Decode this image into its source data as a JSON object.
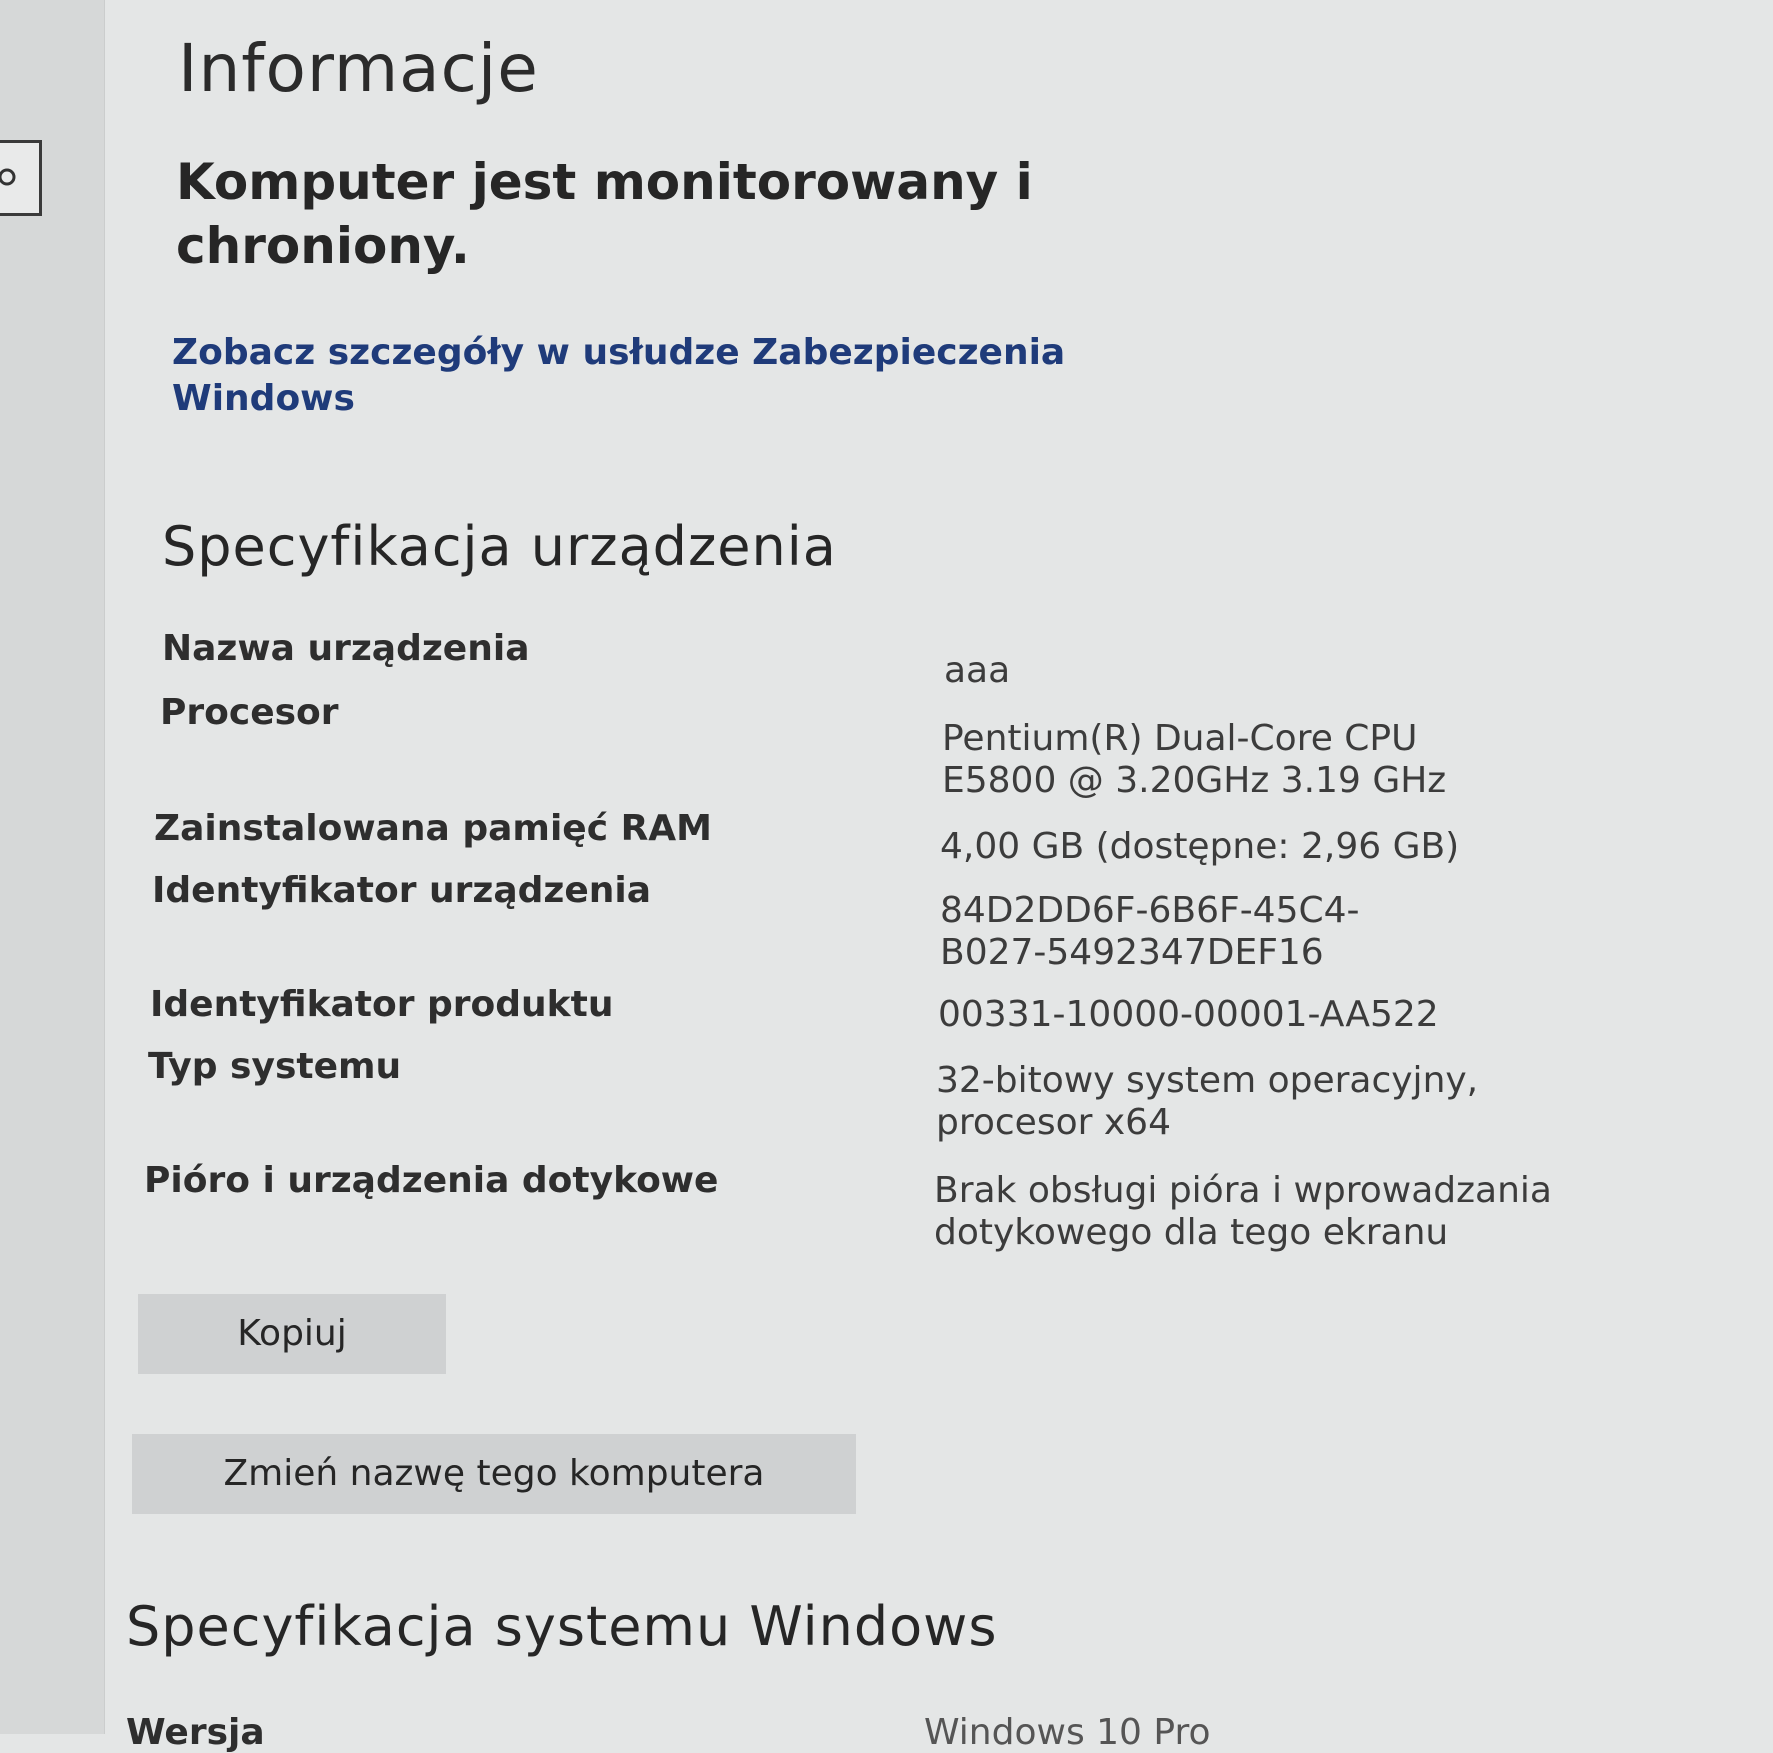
{
  "page": {
    "title": "Informacje",
    "protection_status": "Komputer jest monitorowany i chroniony.",
    "security_link": "Zobacz szczegóły w usłudze Zabezpieczenia Windows"
  },
  "device_spec": {
    "title": "Specyfikacja urządzenia",
    "rows": [
      {
        "label": "Nazwa urządzenia",
        "value": "aaa"
      },
      {
        "label": "Procesor",
        "value": "Pentium(R) Dual-Core  CPU      E5800  @ 3.20GHz   3.19 GHz"
      },
      {
        "label": "Zainstalowana pamięć RAM",
        "value": "4,00 GB (dostępne: 2,96 GB)"
      },
      {
        "label": "Identyfikator urządzenia",
        "value": "84D2DD6F-6B6F-45C4-B027-5492347DEF16"
      },
      {
        "label": "Identyfikator produktu",
        "value": "00331-10000-00001-AA522"
      },
      {
        "label": "Typ systemu",
        "value": "32-bitowy system operacyjny, procesor x64"
      },
      {
        "label": "Pióro i urządzenia dotykowe",
        "value": "Brak obsługi pióra i wprowadzania dotykowego dla tego ekranu"
      }
    ],
    "copy_button": "Kopiuj",
    "rename_button": "Zmień nazwę tego komputera"
  },
  "windows_spec": {
    "title": "Specyfikacja systemu Windows",
    "partial_row": {
      "label": "Wersja",
      "value": "Windows 10 Pro"
    }
  },
  "icons": {
    "search": "search-icon"
  }
}
